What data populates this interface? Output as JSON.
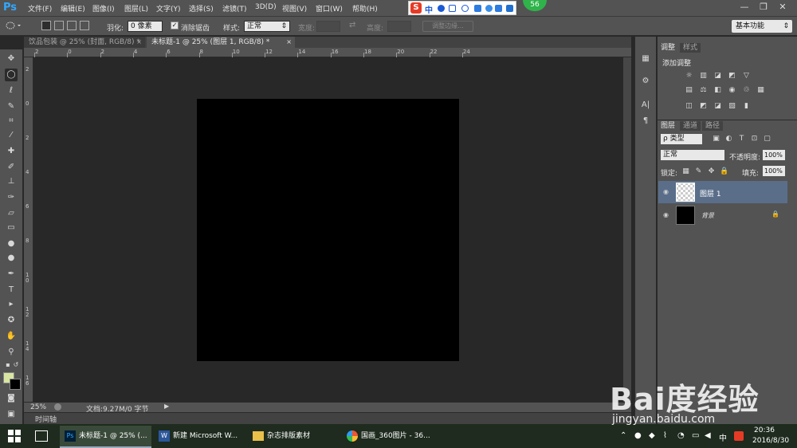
{
  "app": {
    "logo": "Ps"
  },
  "menu": [
    "文件(F)",
    "编辑(E)",
    "图像(I)",
    "图层(L)",
    "文字(Y)",
    "选择(S)",
    "滤镜(T)",
    "3D(D)",
    "视图(V)",
    "窗口(W)",
    "帮助(H)"
  ],
  "ime": {
    "s_label": "S",
    "mode": "中"
  },
  "badge": "56",
  "window_controls": {
    "minimize": "—",
    "restore": "❐",
    "close": "✕"
  },
  "options": {
    "feather_label": "羽化:",
    "feather_value": "0 像素",
    "antialias_label": "消除锯齿",
    "style_label": "样式:",
    "style_value": "正常",
    "width_label": "宽度:",
    "height_label": "高度:",
    "refine_edge": "调整边缘...",
    "workspace": "基本功能"
  },
  "tabs": [
    {
      "label": "饮品包装 @ 25% (封面, RGB/8) *",
      "close": "×"
    },
    {
      "label": "未标题-1 @ 25% (图层 1, RGB/8) *",
      "close": "×"
    }
  ],
  "ruler_top": [
    "2",
    "0",
    "2",
    "4",
    "6",
    "8",
    "1\n0",
    "1\n2",
    "1\n4",
    "1\n6",
    "1\n8",
    "2\n0",
    "2\n2",
    "2\n4"
  ],
  "ruler_top_flat": [
    "2",
    "0",
    "2",
    "4",
    "6",
    "8",
    "10",
    "12",
    "14",
    "16",
    "18",
    "20",
    "22",
    "24"
  ],
  "ruler_left": [
    "2",
    "0",
    "2",
    "4",
    "6",
    "8",
    "1\n0",
    "1\n2",
    "1\n4",
    "1\n6"
  ],
  "status": {
    "zoom": "25%",
    "doc": "文档:9.27M/0 字节"
  },
  "timeline": "时间轴",
  "panels": {
    "adjust_tab": "调整",
    "style_tab": "样式",
    "add_adjust": "添加调整",
    "layers_tab": "图层",
    "channels_tab": "通道",
    "paths_tab": "路径",
    "filter_kind": "ρ 类型",
    "blend_mode": "正常",
    "opacity_label": "不透明度:",
    "opacity_value": "100%",
    "lock_label": "锁定:",
    "fill_label": "填充:",
    "fill_value": "100%",
    "layers": [
      {
        "name": "图层 1"
      },
      {
        "name": "背景"
      }
    ]
  },
  "taskbar": {
    "items": [
      {
        "label": "未标题-1 @ 25% (..."
      },
      {
        "label": "新建 Microsoft W..."
      },
      {
        "label": "杂志排版素材"
      },
      {
        "label": "国画_360图片 - 36..."
      }
    ],
    "ime": "中",
    "time": "20:36",
    "date": "2016/8/30"
  },
  "watermark": {
    "text": "Bai度经验",
    "url": "jingyan.baidu.com"
  },
  "colors": {
    "foreground": "#d8e6a2",
    "background": "#000000",
    "accent": "#31a8ff"
  }
}
